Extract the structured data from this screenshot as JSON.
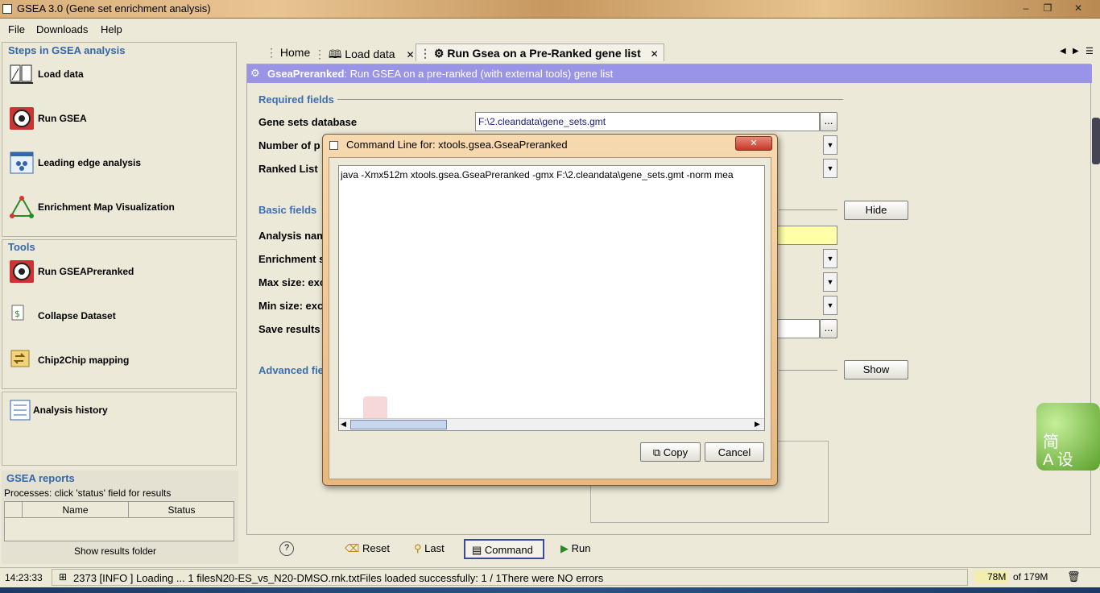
{
  "window": {
    "title": "GSEA 3.0 (Gene set enrichment analysis)",
    "controls": [
      "–",
      "❐",
      "✕"
    ]
  },
  "menu": [
    "File",
    "Downloads",
    "Help"
  ],
  "steps_panel": {
    "title": "Steps in GSEA analysis",
    "items": [
      {
        "label": "Load data",
        "icon": "load-data-icon"
      },
      {
        "label": "Run GSEA",
        "icon": "gear-icon"
      },
      {
        "label": "Leading edge analysis",
        "icon": "leading-edge-icon"
      },
      {
        "label": "Enrichment Map Visualization",
        "icon": "triangle-network-icon"
      }
    ]
  },
  "tools_panel": {
    "title": "Tools",
    "items": [
      {
        "label": "Run GSEAPreranked",
        "icon": "gear-icon"
      },
      {
        "label": "Collapse Dataset",
        "icon": "collapse-icon"
      },
      {
        "label": "Chip2Chip mapping",
        "icon": "chip-mapping-icon"
      }
    ]
  },
  "history": {
    "label": "Analysis history"
  },
  "reports": {
    "title": "GSEA reports",
    "hint": "Processes: click 'status' field for results",
    "columns": [
      "Name",
      "Status"
    ],
    "show_results": "Show results folder"
  },
  "tabs": [
    {
      "label": "Home"
    },
    {
      "label": "Load data",
      "close": "✕"
    },
    {
      "label": "Run Gsea on a Pre-Ranked gene list",
      "close": "✕"
    }
  ],
  "main": {
    "banner_title": "GseaPreranked",
    "banner_desc": ": Run GSEA on a pre-ranked (with external tools) gene list",
    "required_title": "Required fields",
    "gene_sets_label": "Gene sets database",
    "gene_sets_value": "F:\\2.cleandata\\gene_sets.gmt",
    "num_perm_label": "Number of p",
    "ranked_list_label": "Ranked List",
    "basic_title": "Basic fields",
    "hide_label": "Hide",
    "analysis_name_label": "Analysis nam",
    "enrichment_label": "Enrichment s",
    "max_size_label": "Max size: exc",
    "min_size_label": "Min size: exc",
    "save_results_label": "Save results i",
    "advanced_title": "Advanced fie",
    "show_label": "Show",
    "browse": "..."
  },
  "footer": {
    "help": "?",
    "reset": "Reset",
    "last": "Last",
    "command": "Command",
    "run": "Run"
  },
  "dialog": {
    "title": "Command Line for: xtools.gsea.GseaPreranked",
    "command": "java -Xmx512m xtools.gsea.GseaPreranked -gmx F:\\2.cleandata\\gene_sets.gmt -norm mea",
    "copy_label": "Copy",
    "cancel_label": "Cancel",
    "close": "✕"
  },
  "status": {
    "time": "14:23:33",
    "message": "2373 [INFO ] Loading ... 1 filesN20-ES_vs_N20-DMSO.rnk.txtFiles loaded successfully: 1 / 1There were NO errors",
    "memory_used": "78M",
    "memory_total": "of 179M"
  },
  "side_widget": {
    "line1": "简",
    "line2": "A 设"
  },
  "colors": {
    "section_blue": "#3a6eb5",
    "banner_purple": "#9a94e6",
    "dialog_frame": "#e9b77f"
  }
}
